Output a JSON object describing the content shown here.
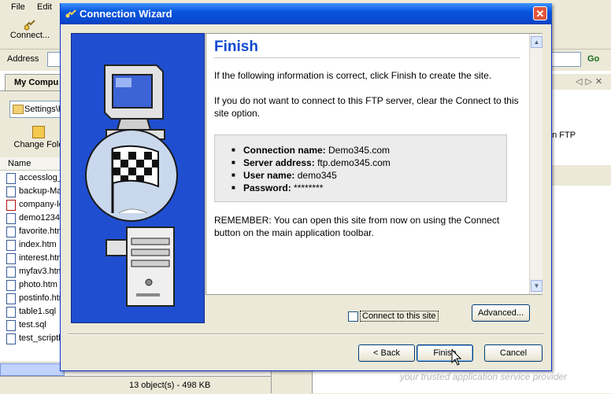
{
  "menubar": {
    "items": [
      "File",
      "Edit"
    ]
  },
  "toolbar": {
    "connect_label": "Connect..."
  },
  "addressbar": {
    "label": "Address",
    "go_label": "Go"
  },
  "left_pane": {
    "tab_label": "My Compu",
    "breadcrumb": "Settings\\R",
    "change_folder_label": "Change Fold",
    "column_name": "Name",
    "files": [
      "accesslog_",
      "backup-Ma",
      "company-lo",
      "demo1234",
      "favorite.htm",
      "index.htm",
      "interest.htm",
      "myfav3.htm",
      "photo.htm",
      "postinfo.htm",
      "table1.sql",
      "test.sql",
      "test_scriptl"
    ],
    "status": "13 object(s) - 498 KB"
  },
  "right_pane": {
    "partial_text": "an FTP"
  },
  "dialog": {
    "title": "Connection Wizard",
    "close_glyph": "✕",
    "heading": "Finish",
    "para1": "If the following information is correct, click Finish to create the site.",
    "para2": "If you do not want to connect to this FTP server, clear the Connect to this site option.",
    "info": [
      {
        "label": "Connection name:",
        "value": "Demo345.com"
      },
      {
        "label": "Server address:",
        "value": "ftp.demo345.com"
      },
      {
        "label": "User name:",
        "value": "demo345"
      },
      {
        "label": "Password:",
        "value": "********"
      }
    ],
    "para3": "REMEMBER: You can open this site from now on using the Connect button on the main application toolbar.",
    "connect_checkbox_label": "Connect to this site",
    "connect_checked": false,
    "advanced_label": "Advanced...",
    "back_label": "< Back",
    "finish_label": "Finish",
    "cancel_label": "Cancel"
  },
  "watermark": "your trusted application service provider",
  "icons": [
    "connect-icon",
    "folder-icon",
    "change-folder-icon",
    "file-icon",
    "wizard-icon",
    "close-icon",
    "scroll-up-icon",
    "scroll-down-icon",
    "cursor-icon"
  ],
  "colors": {
    "titlebar": "#0a4ad0",
    "heading": "#0a4ad0",
    "art_bg": "#1f4fd0",
    "close": "#e0553a"
  }
}
